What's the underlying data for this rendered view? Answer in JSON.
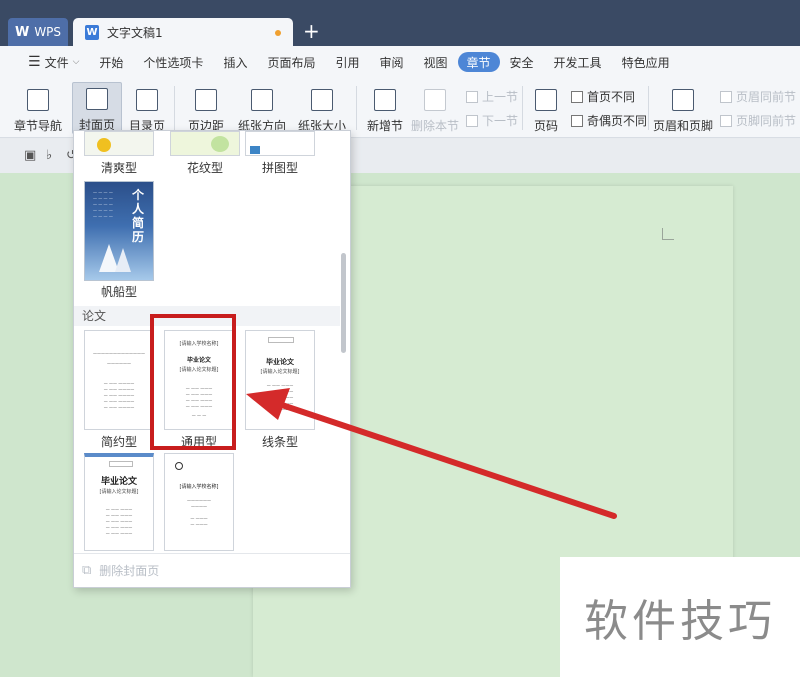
{
  "titlebar": {
    "wps_tab": "WPS",
    "doc_tab": "文字文稿1",
    "doc_icon": "W"
  },
  "menu": {
    "file": "文件",
    "items": [
      "开始",
      "个性选项卡",
      "插入",
      "页面布局",
      "引用",
      "审阅",
      "视图",
      "章节",
      "安全",
      "开发工具",
      "特色应用"
    ],
    "active": "章节"
  },
  "ribbon": {
    "section_nav": "章节导航",
    "cover_page": "封面页",
    "toc_page": "目录页",
    "margin": "页边距",
    "orientation": "纸张方向",
    "paper_size": "纸张大小",
    "new_section": "新增节",
    "delete_section": "删除本节",
    "prev_section": "上一节",
    "next_section": "下一节",
    "page_number": "页码",
    "first_page_diff": "首页不同",
    "odd_even_diff": "奇偶页不同",
    "header_footer": "页眉和页脚",
    "header_link_prev": "页眉同前节",
    "footer_link_prev": "页脚同前节"
  },
  "dropdown": {
    "top_items": [
      "清爽型",
      "花纹型",
      "拼图型"
    ],
    "sailboat": "帆船型",
    "sailboat_text": "个人简历",
    "section_thesis": "论文",
    "thesis_items": [
      "简约型",
      "通用型",
      "线条型"
    ],
    "thumb_text": {
      "school": "[请输入学校名称]",
      "thesis": "毕业论文",
      "thesis_title": "[请输入论文标题]"
    },
    "delete_cover": "删除封面页"
  },
  "watermark": "软件技巧",
  "colors": {
    "accent": "#4d86d6",
    "highlight": "#c81d1d",
    "doc_background": "#cfe6cd"
  }
}
